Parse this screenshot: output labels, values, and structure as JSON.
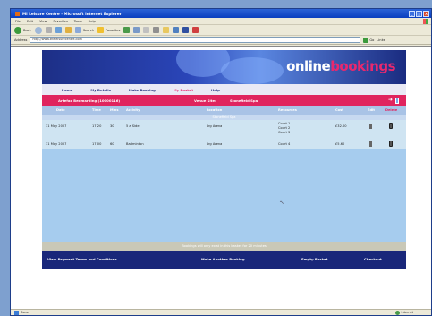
{
  "window": {
    "title": "MI Leisure Centre - Microsoft Internet Explorer"
  },
  "menubar": {
    "items": [
      "File",
      "Edit",
      "View",
      "Favorites",
      "Tools",
      "Help"
    ]
  },
  "toolbar": {
    "back_label": "Back",
    "search_label": "Search",
    "favorites_label": "Favorites"
  },
  "addressbar": {
    "label": "Address",
    "url": "http://www.theleisurecentre.com",
    "go_label": "Go",
    "links_label": "Links"
  },
  "site": {
    "logo_part1": "online",
    "logo_part2": "bookings",
    "nav": [
      "Home",
      "My Details",
      "Make Booking",
      "My Basket",
      "Help"
    ],
    "nav_active_index": 3,
    "user_bar": {
      "user": "Artefax Bedmarding (10000116)",
      "venue_label": "Venue Site:",
      "venue_name": "Stonefield Spa"
    },
    "table": {
      "headers": [
        "Date",
        "Time",
        "Mins",
        "Activity",
        "Location",
        "Resources",
        "Cost",
        "Edit",
        "Delete"
      ],
      "group": "Stonefield Spa",
      "rows": [
        {
          "date": "31 May 2007",
          "time": "17:20",
          "mins": "30",
          "activity": "5 a Side",
          "location": "Lrg Arena",
          "resources": [
            "Court 1",
            "Court 2",
            "Court 3"
          ],
          "cost": "£32.00"
        },
        {
          "date": "31 May 2007",
          "time": "17:00",
          "mins": "60",
          "activity": "Badminton",
          "location": "Lrg Arena",
          "resources": [
            "Court 4"
          ],
          "cost": "£5.60"
        }
      ]
    },
    "notice": "Bookings will only exist in this basket for 20 minutes",
    "footer": [
      "View Payment Terms and Conditions",
      "Make Another Booking",
      "Empty Basket",
      "Checkout"
    ]
  },
  "statusbar": {
    "left": "Done",
    "zone": "Internet"
  },
  "colors": {
    "brand_pink": "#e0245e",
    "brand_navy": "#19277a",
    "row_blue": "#cfe4f2"
  }
}
